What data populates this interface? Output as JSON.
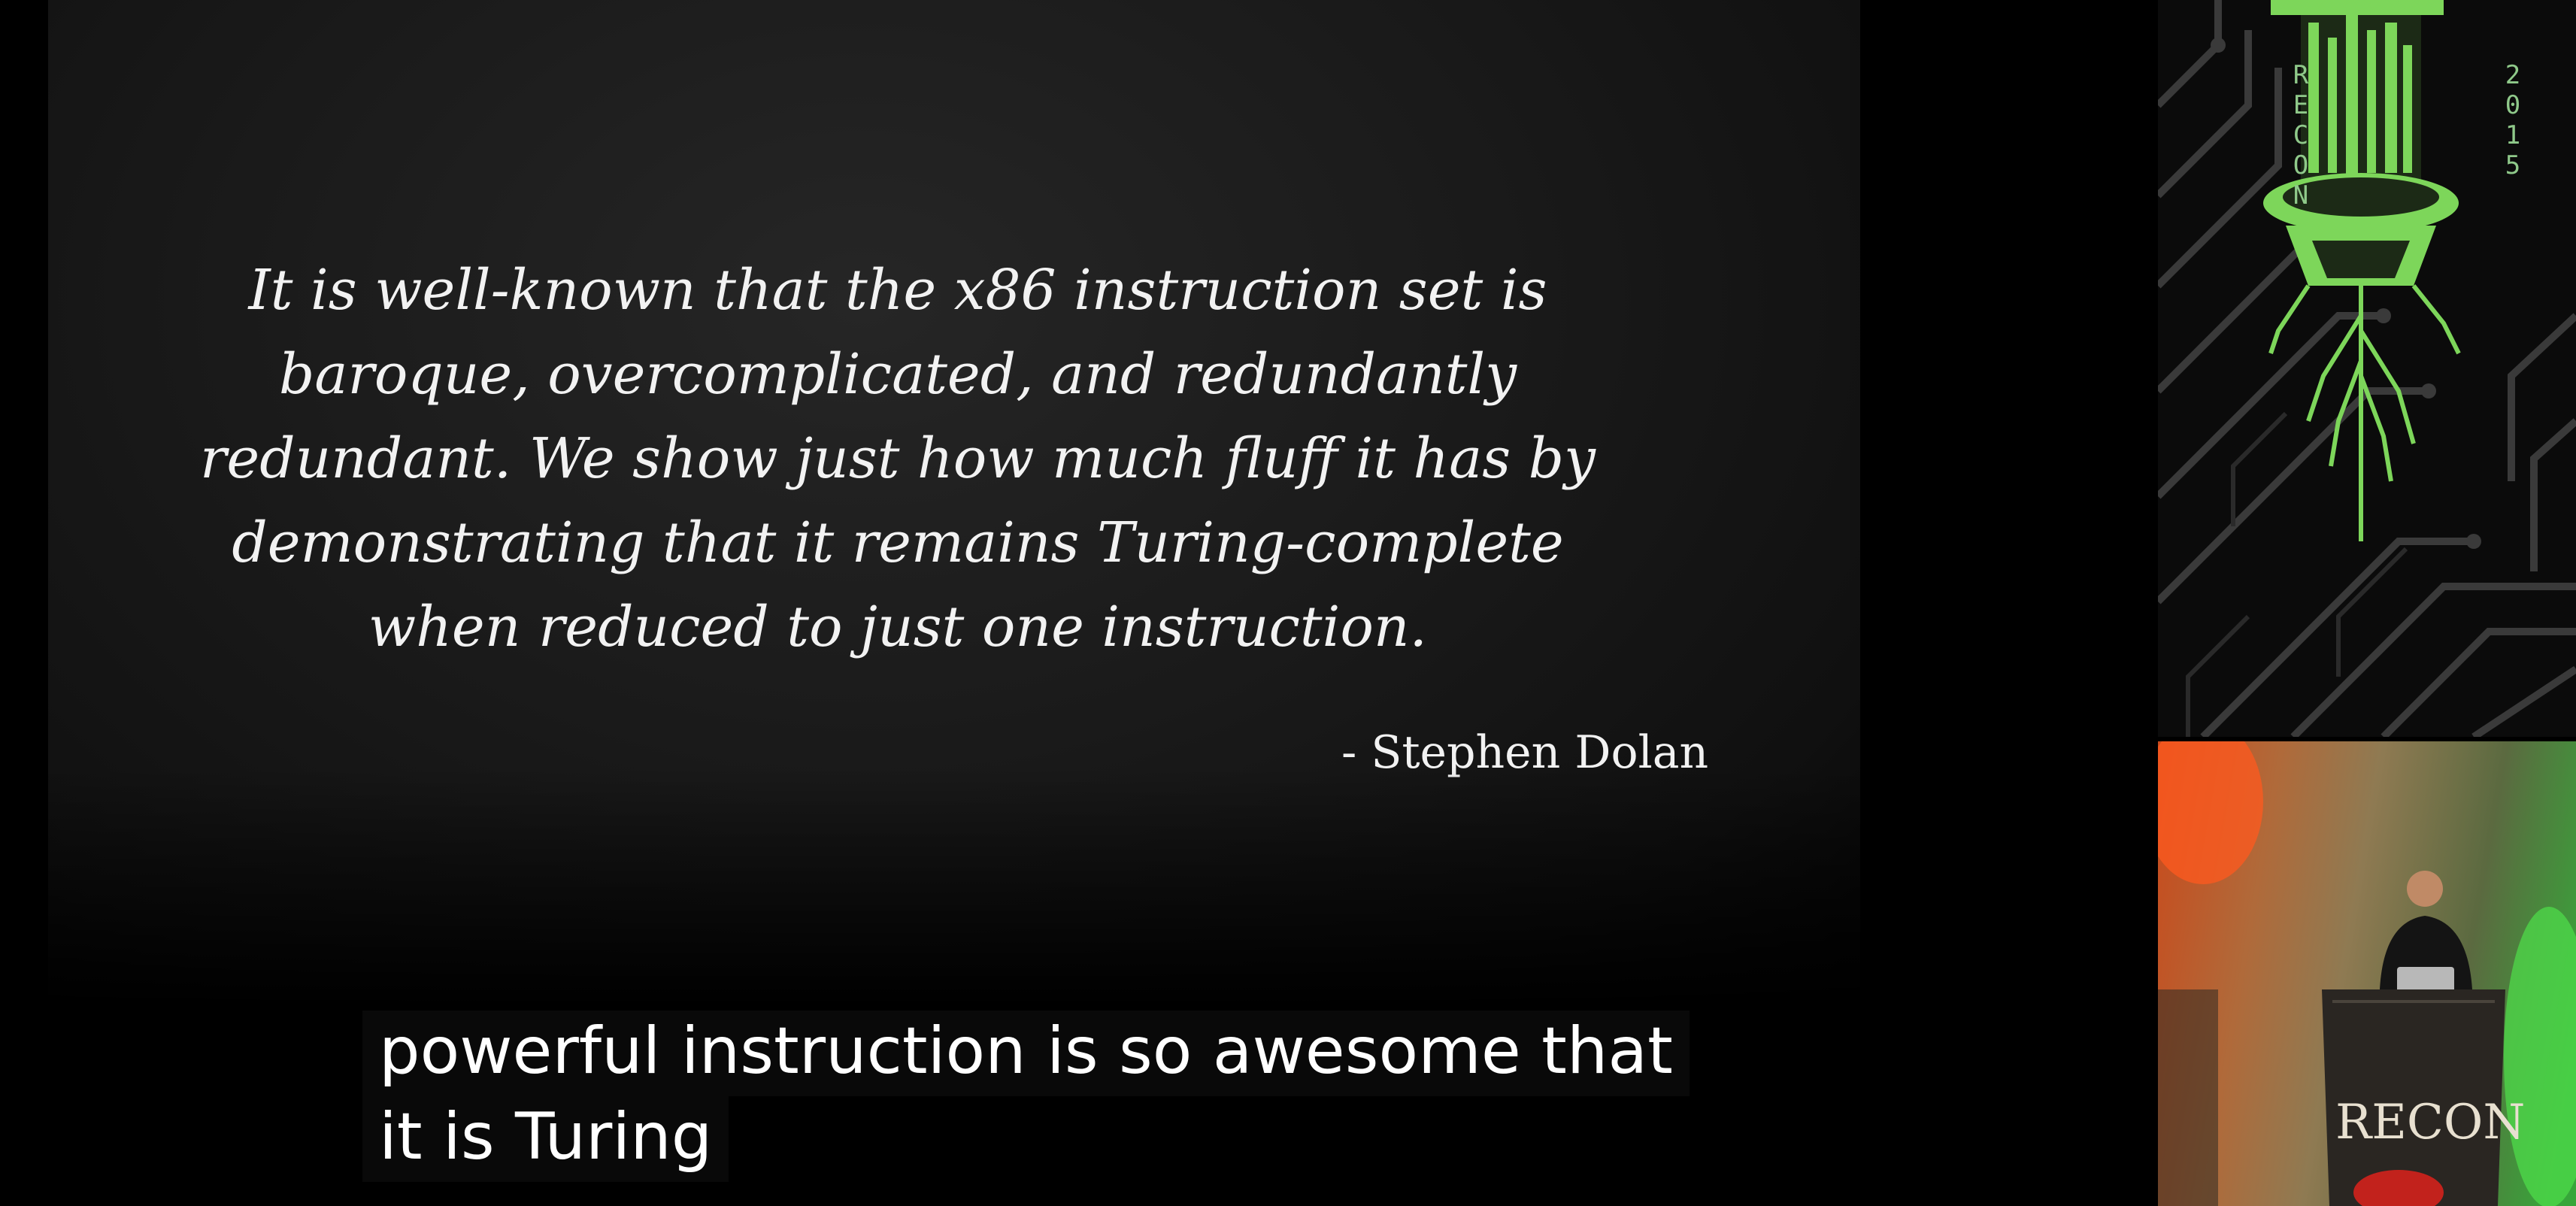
{
  "slide": {
    "quote_lines": [
      "It is well-known that the x86 instruction set is",
      "baroque, overcomplicated, and redundantly",
      "redundant. We show just how much fluff it has by",
      "demonstrating that it remains Turing-complete",
      "when reduced to just one instruction."
    ],
    "author": "- Stephen Dolan"
  },
  "captions": {
    "line1": "powerful instruction is so awesome that",
    "line2": "it is Turing"
  },
  "sidebar": {
    "logo_letters_left": "RECON",
    "logo_letters_right": "2015",
    "podium_text": "RECON"
  },
  "colors": {
    "logo_green": "#7dd65a",
    "caption_bg": "#0a0a0a"
  }
}
